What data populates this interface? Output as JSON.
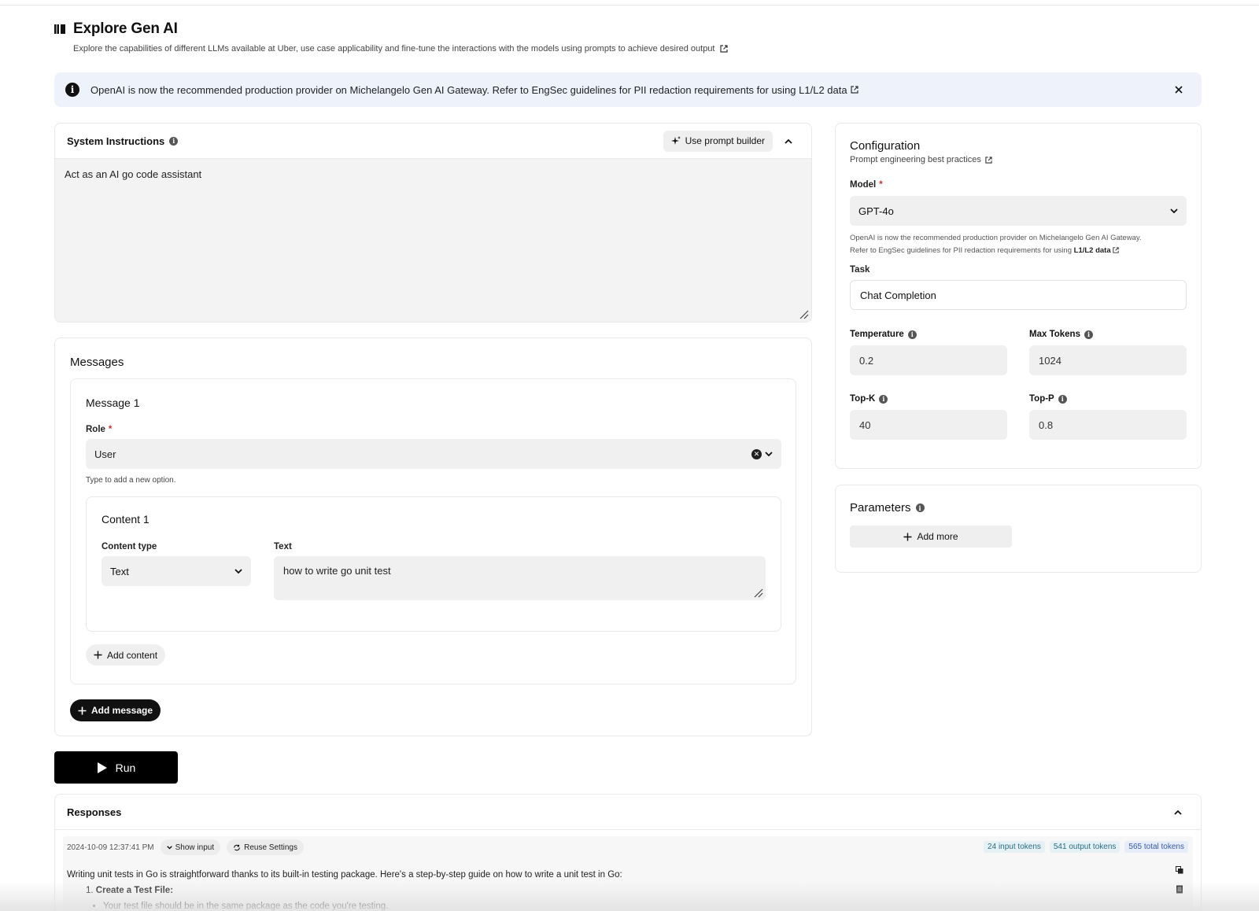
{
  "header": {
    "title": "Explore Gen AI",
    "subtitle": "Explore the capabilities of different LLMs available at Uber, use case applicability and fine-tune the interactions with the models using prompts to achieve desired output"
  },
  "banner": {
    "text": "OpenAI is now the recommended production provider on Michelangelo Gen AI Gateway. Refer to EngSec guidelines for PII redaction requirements for using L1/L2 data"
  },
  "system_instructions": {
    "title": "System Instructions",
    "prompt_builder_label": "Use prompt builder",
    "value": "Act as an AI go code assistant"
  },
  "messages": {
    "title": "Messages",
    "message1": {
      "title": "Message 1",
      "role_label": "Role",
      "role_required": "*",
      "role_value": "User",
      "role_hint": "Type to add a new option.",
      "content1": {
        "title": "Content 1",
        "content_type_label": "Content type",
        "content_type_value": "Text",
        "text_label": "Text",
        "text_value": "how to write go unit test"
      },
      "add_content_label": "Add content"
    },
    "add_message_label": "Add message"
  },
  "run_label": "Run",
  "configuration": {
    "title": "Configuration",
    "best_practices_link": "Prompt engineering best practices",
    "model_label": "Model",
    "model_required": "*",
    "model_value": "GPT-4o",
    "model_hint_line1": "OpenAI is now the recommended production provider on Michelangelo Gen AI Gateway.",
    "model_hint_line2": "Refer to EngSec guidelines for PII redaction requirements for using",
    "model_hint_bold": "L1/L2 data",
    "task_label": "Task",
    "task_value": "Chat Completion",
    "temperature_label": "Temperature",
    "temperature_value": "0.2",
    "max_tokens_label": "Max Tokens",
    "max_tokens_value": "1024",
    "top_k_label": "Top-K",
    "top_k_value": "40",
    "top_p_label": "Top-P",
    "top_p_value": "0.8"
  },
  "parameters": {
    "title": "Parameters",
    "add_more_label": "Add more"
  },
  "responses": {
    "title": "Responses",
    "timestamp": "2024-10-09 12:37:41 PM",
    "show_input_label": "Show input",
    "reuse_settings_label": "Reuse Settings",
    "input_tokens": "24 input tokens",
    "output_tokens": "541 output tokens",
    "total_tokens": "565 total tokens",
    "intro": "Writing unit tests in Go is straightforward thanks to its built-in testing package. Here's a step-by-step guide on how to write a unit test in Go:",
    "step1_number": "1.",
    "step1_title": "Create a Test File",
    "step1_bullet": "Your test file should be in the same package as the code you're testing."
  }
}
